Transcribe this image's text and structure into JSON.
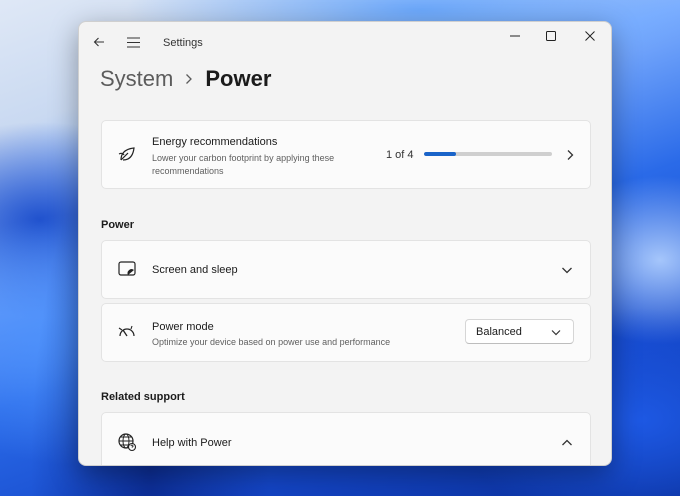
{
  "window": {
    "title": "Settings",
    "back_icon": "back-arrow-icon",
    "menu_icon": "hamburger-menu-icon",
    "controls": [
      "minimize-icon",
      "maximize-icon",
      "close-icon"
    ]
  },
  "breadcrumb": {
    "parent": "System",
    "current": "Power"
  },
  "energy": {
    "title": "Energy recommendations",
    "subtitle_line1": "Lower your carbon footprint by applying these",
    "subtitle_line2": "recommendations",
    "progress_text": "1 of 4",
    "progress_fraction": 0.25,
    "icon": "leaf-icon"
  },
  "power_section": {
    "heading": "Power",
    "screen_sleep": {
      "label": "Screen and sleep",
      "icon": "screen-sleep-icon"
    },
    "power_mode": {
      "label": "Power mode",
      "description": "Optimize your device based on power use and performance",
      "value": "Balanced",
      "icon": "gauge-icon"
    }
  },
  "related_support": {
    "heading": "Related support",
    "help": {
      "label": "Help with Power",
      "icon": "globe-help-icon"
    }
  },
  "colors": {
    "accent": "#1a64c9",
    "window_bg": "#f3f3f3",
    "card_bg": "#fbfbfb"
  }
}
